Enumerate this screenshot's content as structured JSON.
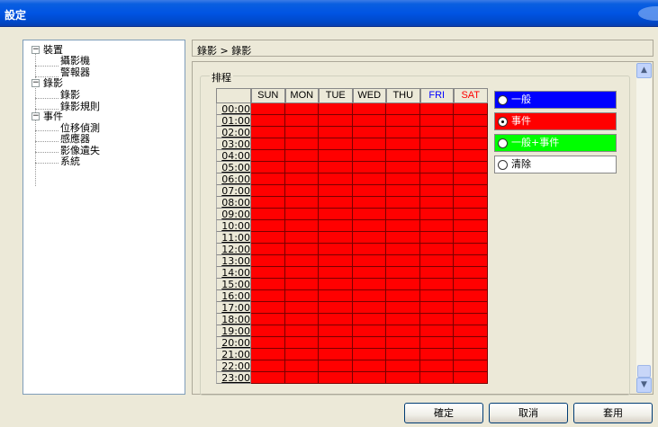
{
  "window": {
    "title": "設定"
  },
  "tree": {
    "nodes": [
      {
        "label": "裝置",
        "expander": "−"
      },
      {
        "label": "攝影機"
      },
      {
        "label": "警報器"
      },
      {
        "label": "錄影",
        "expander": "−"
      },
      {
        "label": "錄影"
      },
      {
        "label": "錄影規則"
      },
      {
        "label": "事件",
        "expander": "−"
      },
      {
        "label": "位移偵測"
      },
      {
        "label": "感應器"
      },
      {
        "label": "影像遺失"
      },
      {
        "label": "系統"
      }
    ]
  },
  "breadcrumb": "錄影 > 錄影",
  "schedule": {
    "group_label": "排程",
    "days": [
      {
        "label": "SUN",
        "color": "#000000"
      },
      {
        "label": "MON",
        "color": "#000000"
      },
      {
        "label": "TUE",
        "color": "#000000"
      },
      {
        "label": "WED",
        "color": "#000000"
      },
      {
        "label": "THU",
        "color": "#000000"
      },
      {
        "label": "FRI",
        "color": "#0000ff"
      },
      {
        "label": "SAT",
        "color": "#ff0000"
      }
    ],
    "hours": [
      "00:00",
      "01:00",
      "02:00",
      "03:00",
      "04:00",
      "05:00",
      "06:00",
      "07:00",
      "08:00",
      "09:00",
      "10:00",
      "11:00",
      "12:00",
      "13:00",
      "14:00",
      "15:00",
      "16:00",
      "17:00",
      "18:00",
      "19:00",
      "20:00",
      "21:00",
      "22:00",
      "23:00"
    ],
    "cell_color": "#ff0000"
  },
  "modes": [
    {
      "label": "一般",
      "color": "#0000ff",
      "text_color": "#ffffff",
      "checked": false
    },
    {
      "label": "事件",
      "color": "#ff0000",
      "text_color": "#ffffff",
      "checked": true
    },
    {
      "label": "一般+事件",
      "color": "#00ff00",
      "text_color": "#ffffff",
      "checked": false
    },
    {
      "label": "清除",
      "color": "#ffffff",
      "text_color": "#000000",
      "checked": false
    }
  ],
  "buttons": {
    "ok": "確定",
    "cancel": "取消",
    "apply": "套用"
  },
  "scroll": {
    "up_icon": "▲",
    "down_icon": "▼"
  }
}
